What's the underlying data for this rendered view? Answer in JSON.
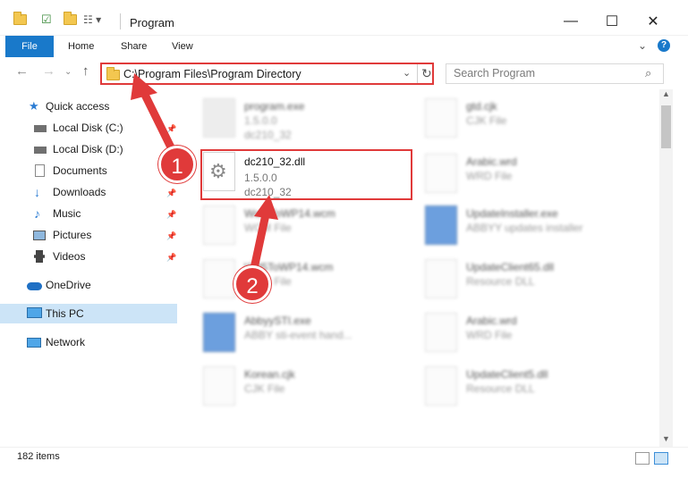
{
  "window": {
    "title": "Program"
  },
  "ribbon": {
    "tabs": [
      "File",
      "Home",
      "Share",
      "View"
    ]
  },
  "address": {
    "path": "C:\\Program Files\\Program Directory",
    "search_placeholder": "Search Program"
  },
  "sidebar": {
    "items": [
      {
        "label": "Quick access"
      },
      {
        "label": "Local Disk (C:)"
      },
      {
        "label": "Local Disk (D:)"
      },
      {
        "label": "Documents"
      },
      {
        "label": "Downloads"
      },
      {
        "label": "Music"
      },
      {
        "label": "Pictures"
      },
      {
        "label": "Videos"
      },
      {
        "label": "OneDrive"
      },
      {
        "label": "This PC"
      },
      {
        "label": "Network"
      }
    ]
  },
  "files": [
    {
      "name": "program.exe",
      "l2": "1.5.0.0",
      "l3": "dc210_32"
    },
    {
      "name": "gtd.cjk",
      "l2": "CJK File",
      "l3": ""
    },
    {
      "name": "dc210_32.dll",
      "l2": "1.5.0.0",
      "l3": "dc210_32"
    },
    {
      "name": "Arabic.wrd",
      "l2": "WRD File",
      "l3": ""
    },
    {
      "name": "WordToWP14.wcm",
      "l2": "WCM File",
      "l3": ""
    },
    {
      "name": "UpdateInstaller.exe",
      "l2": "ABBYY updates installer",
      "l3": ""
    },
    {
      "name": "WP5ToWP14.wcm",
      "l2": "WCM File",
      "l3": ""
    },
    {
      "name": "UpdateClient65.dll",
      "l2": "Resource DLL",
      "l3": ""
    },
    {
      "name": "AbbyySTI.exe",
      "l2": "ABBY sti-event hand...",
      "l3": ""
    },
    {
      "name": "Arabic.wrd",
      "l2": "WRD File",
      "l3": ""
    },
    {
      "name": "Korean.cjk",
      "l2": "CJK File",
      "l3": ""
    },
    {
      "name": "UpdateClient5.dll",
      "l2": "Resource DLL",
      "l3": ""
    }
  ],
  "status": {
    "count": "182 items"
  },
  "badges": [
    "1",
    "2"
  ],
  "colors": {
    "accent": "#1979ca",
    "highlight": "#e03a3a",
    "selected": "#cce4f7"
  }
}
